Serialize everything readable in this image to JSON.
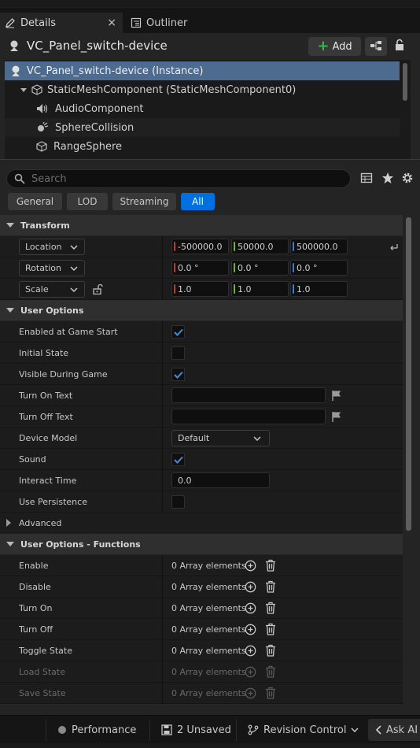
{
  "tabs": [
    {
      "label": "Details",
      "icon": "pencil-icon",
      "active": true
    },
    {
      "label": "Outliner",
      "icon": "outliner-icon",
      "active": false
    }
  ],
  "tab_close": "×",
  "actor": {
    "name": "VC_Panel_switch-device",
    "add_label": "Add"
  },
  "tree": [
    {
      "label": "VC_Panel_switch-device (Instance)",
      "icon": "actor-icon"
    },
    {
      "label": "StaticMeshComponent (StaticMeshComponent0)",
      "icon": "cube-icon"
    },
    {
      "label": "AudioComponent",
      "icon": "speaker-icon"
    },
    {
      "label": "SphereCollision",
      "icon": "collision-icon"
    },
    {
      "label": "RangeSphere",
      "icon": "cube-icon"
    }
  ],
  "search": {
    "placeholder": "Search"
  },
  "filters": [
    "General",
    "LOD",
    "Streaming",
    "All"
  ],
  "active_filter": "All",
  "transform": {
    "title": "Transform",
    "location": {
      "label": "Location",
      "x": "-500000.0",
      "y": "50000.0",
      "z": "500000.0"
    },
    "rotation": {
      "label": "Rotation",
      "x": "0.0 °",
      "y": "0.0 °",
      "z": "0.0 °"
    },
    "scale": {
      "label": "Scale",
      "x": "1.0",
      "y": "1.0",
      "z": "1.0"
    }
  },
  "user_options": {
    "title": "User Options",
    "enabled_at_game_start": {
      "label": "Enabled at Game Start",
      "checked": true
    },
    "initial_state": {
      "label": "Initial State",
      "checked": false
    },
    "visible_during_game": {
      "label": "Visible During Game",
      "checked": true
    },
    "turn_on_text": {
      "label": "Turn On Text",
      "value": ""
    },
    "turn_off_text": {
      "label": "Turn Off Text",
      "value": ""
    },
    "device_model": {
      "label": "Device Model",
      "value": "Default"
    },
    "sound": {
      "label": "Sound",
      "checked": true
    },
    "interact_time": {
      "label": "Interact Time",
      "value": "0.0"
    },
    "use_persistence": {
      "label": "Use Persistence",
      "checked": false
    },
    "advanced": "Advanced"
  },
  "functions": {
    "title": "User Options - Functions",
    "array_text": "0 Array elements",
    "items": [
      {
        "label": "Enable",
        "enabled": true
      },
      {
        "label": "Disable",
        "enabled": true
      },
      {
        "label": "Turn On",
        "enabled": true
      },
      {
        "label": "Turn Off",
        "enabled": true
      },
      {
        "label": "Toggle State",
        "enabled": true
      },
      {
        "label": "Load State",
        "enabled": false
      },
      {
        "label": "Save State",
        "enabled": false
      }
    ]
  },
  "statusbar": {
    "performance": "Performance",
    "unsaved": "2 Unsaved",
    "revision": "Revision Control",
    "ask_ai": "Ask AI"
  },
  "colors": {
    "accent": "#0070e0",
    "selection": "#4d6a8f",
    "axis_x": "#c0392b",
    "axis_y": "#6ab04c",
    "axis_z": "#3a7bd5",
    "add_green": "#33b84a"
  }
}
